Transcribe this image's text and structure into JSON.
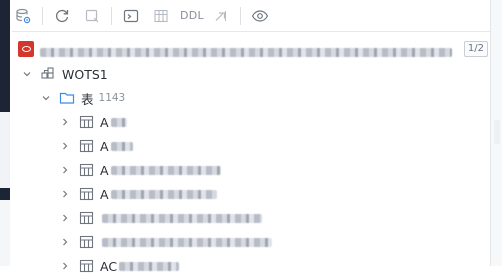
{
  "toolbar": {
    "ddl_label": "DDL"
  },
  "connection": {
    "match_count": "1/2"
  },
  "tree": {
    "schema_label": "WOTS1",
    "folder_label": "表",
    "folder_count": "1143",
    "tables": [
      {
        "prefix": "A"
      },
      {
        "prefix": "A"
      },
      {
        "prefix": "A"
      },
      {
        "prefix": "A"
      },
      {
        "prefix": ""
      },
      {
        "prefix": ""
      },
      {
        "prefix": "AC"
      }
    ]
  },
  "colors": {
    "oracle": "#d3362c",
    "folder": "#3d8be6",
    "icon": "#8a9099"
  }
}
